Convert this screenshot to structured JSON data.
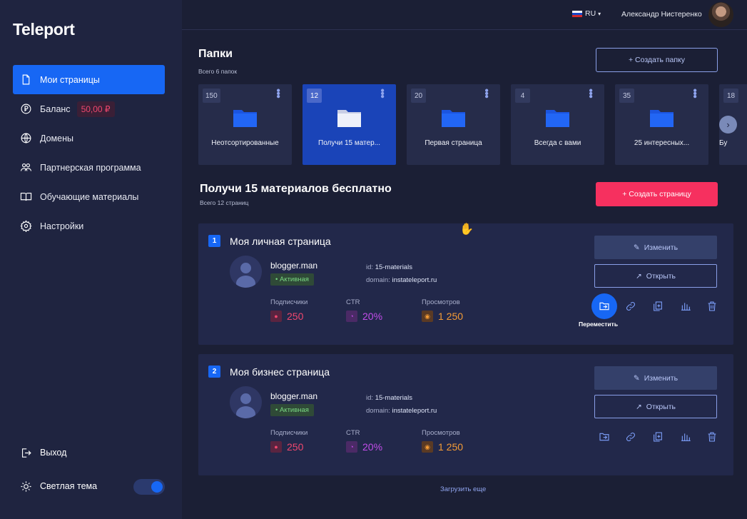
{
  "sidebar": {
    "logo": "Teleport",
    "items": [
      {
        "label": "Мои страницы",
        "icon": "file-icon"
      },
      {
        "label": "Баланс",
        "icon": "ruble-coin-icon",
        "badge": "50,00 ₽"
      },
      {
        "label": "Домены",
        "icon": "globe-icon"
      },
      {
        "label": "Партнерская программа",
        "icon": "partners-icon"
      },
      {
        "label": "Обучающие материалы",
        "icon": "book-icon"
      },
      {
        "label": "Настройки",
        "icon": "gear-icon"
      }
    ],
    "logout": "Выход",
    "theme_label": "Светлая тема"
  },
  "topbar": {
    "lang": "RU",
    "user_name": "Александр Нистеренко"
  },
  "folders_section": {
    "title": "Папки",
    "subtitle": "Всего 6 папок",
    "create_button": "+ Создать папку",
    "folders": [
      {
        "count": "150",
        "label": "Неотсортированные"
      },
      {
        "count": "12",
        "label": "Получи 15 матер..."
      },
      {
        "count": "20",
        "label": "Первая страница"
      },
      {
        "count": "4",
        "label": "Всегда с вами"
      },
      {
        "count": "35",
        "label": "25 интересных..."
      },
      {
        "count": "18",
        "label": "Бу"
      }
    ]
  },
  "pages_section": {
    "title": "Получи 15 материалов бесплатно",
    "subtitle": "Всего 12 страниц",
    "create_button": "+ Создать страницу",
    "load_more": "Загрузить еще",
    "move_tooltip": "Переместить",
    "pages": [
      {
        "num": "1",
        "title": "Моя личная страница",
        "user": "blogger.man",
        "status": "• Активная",
        "id_label": "id:",
        "id_value": "15-materials",
        "domain_label": "domain:",
        "domain_value": "instateleport.ru",
        "subs_label": "Подписчики",
        "subs_value": "250",
        "ctr_label": "CTR",
        "ctr_value": "20%",
        "views_label": "Просмотров",
        "views_value": "1 250",
        "edit_button": "Изменить",
        "open_button": "Открыть"
      },
      {
        "num": "2",
        "title": "Моя бизнес страница",
        "user": "blogger.man",
        "status": "• Активная",
        "id_label": "id:",
        "id_value": "15-materials",
        "domain_label": "domain:",
        "domain_value": "instateleport.ru",
        "subs_label": "Подписчики",
        "subs_value": "250",
        "ctr_label": "CTR",
        "ctr_value": "20%",
        "views_label": "Просмотров",
        "views_value": "1 250",
        "edit_button": "Изменить",
        "open_button": "Открыть"
      }
    ]
  },
  "colors": {
    "accent": "#1767f4",
    "danger": "#f6305f",
    "subs": "#f0476e",
    "ctr": "#c24dea",
    "views": "#f49b35"
  }
}
